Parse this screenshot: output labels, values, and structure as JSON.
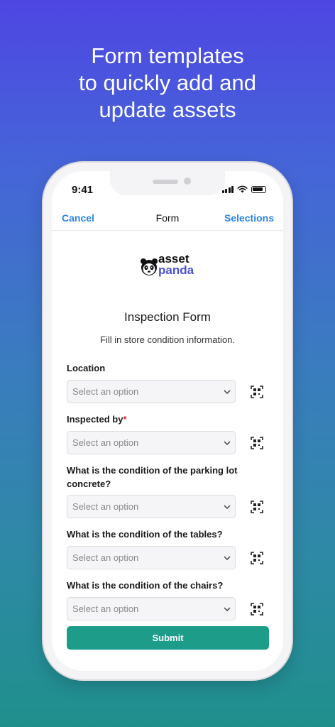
{
  "headline": {
    "line1": "Form templates",
    "line2": "to quickly add and",
    "line3": "update assets"
  },
  "status_bar": {
    "time": "9:41"
  },
  "nav": {
    "cancel_label": "Cancel",
    "title": "Form",
    "selections_label": "Selections"
  },
  "logo": {
    "word1": "asset",
    "word2": "panda"
  },
  "form": {
    "title": "Inspection Form",
    "description": "Fill in store condition information.",
    "fields": [
      {
        "label": "Location",
        "required": false,
        "placeholder": "Select an option"
      },
      {
        "label": "Inspected by",
        "required": true,
        "required_mark": "*",
        "placeholder": "Select an option"
      },
      {
        "label": "What is the condition of the parking lot concrete?",
        "required": false,
        "placeholder": "Select an option"
      },
      {
        "label": "What is the condition of the tables?",
        "required": false,
        "placeholder": "Select an option"
      },
      {
        "label": "What is the condition of the chairs?",
        "required": false,
        "placeholder": "Select an option"
      }
    ],
    "submit_label": "Submit"
  },
  "colors": {
    "link": "#2b84e6",
    "submit": "#1e9c8a",
    "required": "#d6243a",
    "brand": "#4b4fd6"
  },
  "icons": {
    "field_action": "qr-scan-icon",
    "select_indicator": "chevron-down-icon"
  }
}
